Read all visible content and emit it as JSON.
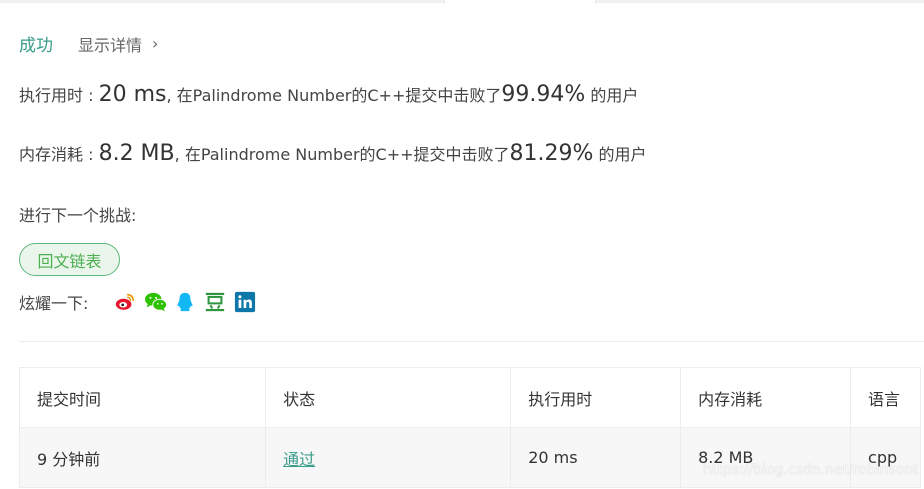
{
  "status": {
    "result": "成功",
    "details_label": "显示详情",
    "details_chevron": "›"
  },
  "runtime": {
    "label": "执行用时 : ",
    "value": "20 ms",
    "middle": ", 在Palindrome Number的C++提交中击败了",
    "percent": "99.94%",
    "suffix": " 的用户"
  },
  "memory": {
    "label": "内存消耗 : ",
    "value": "8.2 MB",
    "middle": ", 在Palindrome Number的C++提交中击败了",
    "percent": "81.29%",
    "suffix": " 的用户"
  },
  "next": {
    "label": "进行下一个挑战:",
    "button": "回文链表"
  },
  "share": {
    "label": "炫耀一下:",
    "icons": [
      "weibo-icon",
      "wechat-icon",
      "qq-icon",
      "douban-icon",
      "linkedin-icon"
    ],
    "colors": {
      "weibo": "#e6162d",
      "wechat": "#2dc100",
      "qq": "#12b7f5",
      "douban": "#2e963d",
      "linkedin": "#0e76a8"
    }
  },
  "table": {
    "headers": [
      "提交时间",
      "状态",
      "执行用时",
      "内存消耗",
      "语言"
    ],
    "rows": [
      {
        "time": "9 分钟前",
        "status": "通过",
        "runtime": "20 ms",
        "memory": "8.2 MB",
        "language": "cpp"
      }
    ]
  },
  "watermark": "https://blog.csdn.net/robinsont",
  "colors": {
    "accent": "#3a9c8b",
    "success_button_border": "#5fb878",
    "success_button_bg": "#eaf6ec"
  }
}
